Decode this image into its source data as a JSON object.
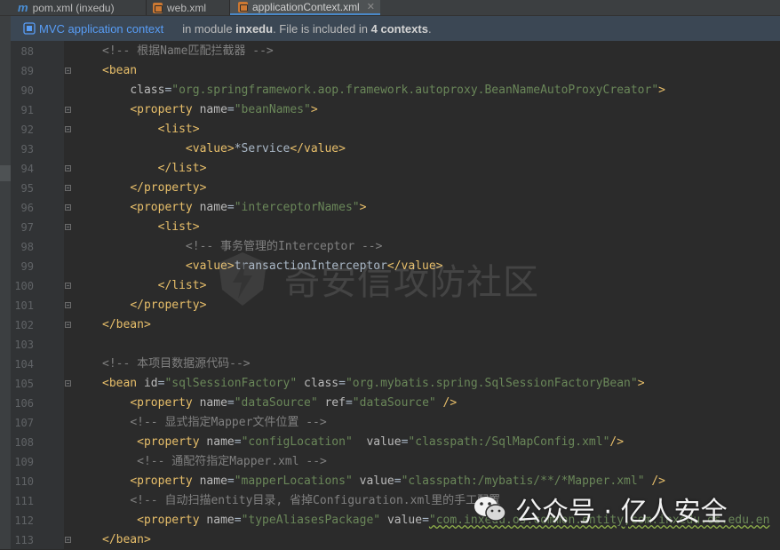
{
  "tabs": [
    {
      "label": "pom.xml (inxedu)",
      "icon": "maven-icon"
    },
    {
      "label": "web.xml",
      "icon": "xml-file-icon"
    },
    {
      "label": "applicationContext.xml",
      "icon": "xml-file-icon",
      "active": true
    }
  ],
  "notice": {
    "link": "MVC application context",
    "text_before": "in module ",
    "module": "inxedu",
    "text_middle": ". File is included in ",
    "contexts": "4 contexts",
    "text_after": "."
  },
  "editor": {
    "lines": [
      {
        "n": "88"
      },
      {
        "n": "89"
      },
      {
        "n": "90"
      },
      {
        "n": "91"
      },
      {
        "n": "92"
      },
      {
        "n": "93"
      },
      {
        "n": "94"
      },
      {
        "n": "95"
      },
      {
        "n": "96"
      },
      {
        "n": "97"
      },
      {
        "n": "98"
      },
      {
        "n": "99"
      },
      {
        "n": "100"
      },
      {
        "n": "101"
      },
      {
        "n": "102"
      },
      {
        "n": "103"
      },
      {
        "n": "104"
      },
      {
        "n": "105"
      },
      {
        "n": "106"
      },
      {
        "n": "107"
      },
      {
        "n": "108"
      },
      {
        "n": "109"
      },
      {
        "n": "110"
      },
      {
        "n": "111"
      },
      {
        "n": "112"
      },
      {
        "n": "113"
      }
    ],
    "text": {
      "c88": "<!-- 根据Name匹配拦截器 -->",
      "l90_class": "class",
      "l90_val": "\"org.springframework.aop.framework.autoproxy.BeanNameAutoProxyCreator\"",
      "l91_val": "\"beanNames\"",
      "l93_text": "*Service",
      "l96_val": "\"interceptorNames\"",
      "c98": "<!-- 事务管理的Interceptor -->",
      "l99_text": "transactionInterceptor",
      "c104": "<!-- 本项目数据源代码-->",
      "l105_id": "\"sqlSessionFactory\"",
      "l105_class": "\"org.mybatis.spring.SqlSessionFactoryBean\"",
      "l106_name": "\"dataSource\"",
      "l106_ref": "\"dataSource\"",
      "c107": "<!-- 显式指定Mapper文件位置 -->",
      "l108_name": "\"configLocation\"",
      "l108_value": "\"classpath:/SqlMapConfig.xml\"",
      "c109": "<!-- 通配符指定Mapper.xml -->",
      "l110_name": "\"mapperLocations\"",
      "l110_value": "\"classpath:/mybatis/**/*Mapper.xml\"",
      "c111": "<!-- 自动扫描entity目录, 省掉Configuration.xml里的手工配置",
      "l112_name": "\"typeAliasesPackage\"",
      "l112_value": "\"com.inxedu.os.common.entity,com.inxedu.os.edu.en"
    }
  },
  "watermark": {
    "center": "奇安信攻防社区",
    "bottom": "公众号 · 亿人安全"
  }
}
